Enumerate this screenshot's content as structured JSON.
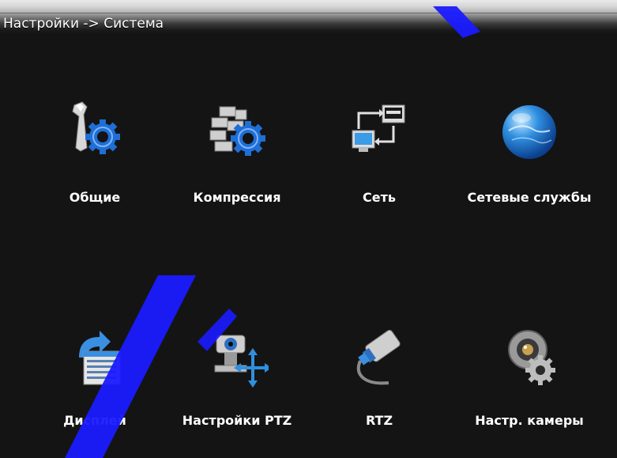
{
  "window": {
    "title": "Настройки -> Система"
  },
  "tiles": [
    {
      "label": "Общие",
      "icon": "wrench-gear-icon"
    },
    {
      "label": "Компрессия",
      "icon": "bricks-gear-icon"
    },
    {
      "label": "Сеть",
      "icon": "network-computers-icon"
    },
    {
      "label": "Сетевые службы",
      "icon": "globe-icon"
    },
    {
      "label": "Дисплей",
      "icon": "display-list-icon"
    },
    {
      "label": "Настройки PTZ",
      "icon": "ptz-camera-arrows-icon"
    },
    {
      "label": "RTZ",
      "icon": "cable-connector-icon"
    },
    {
      "label": "Настр. камеры",
      "icon": "webcam-gear-icon"
    }
  ],
  "colors": {
    "background": "#141414",
    "label": "#ffffff",
    "watermark": "#1a1aff"
  }
}
